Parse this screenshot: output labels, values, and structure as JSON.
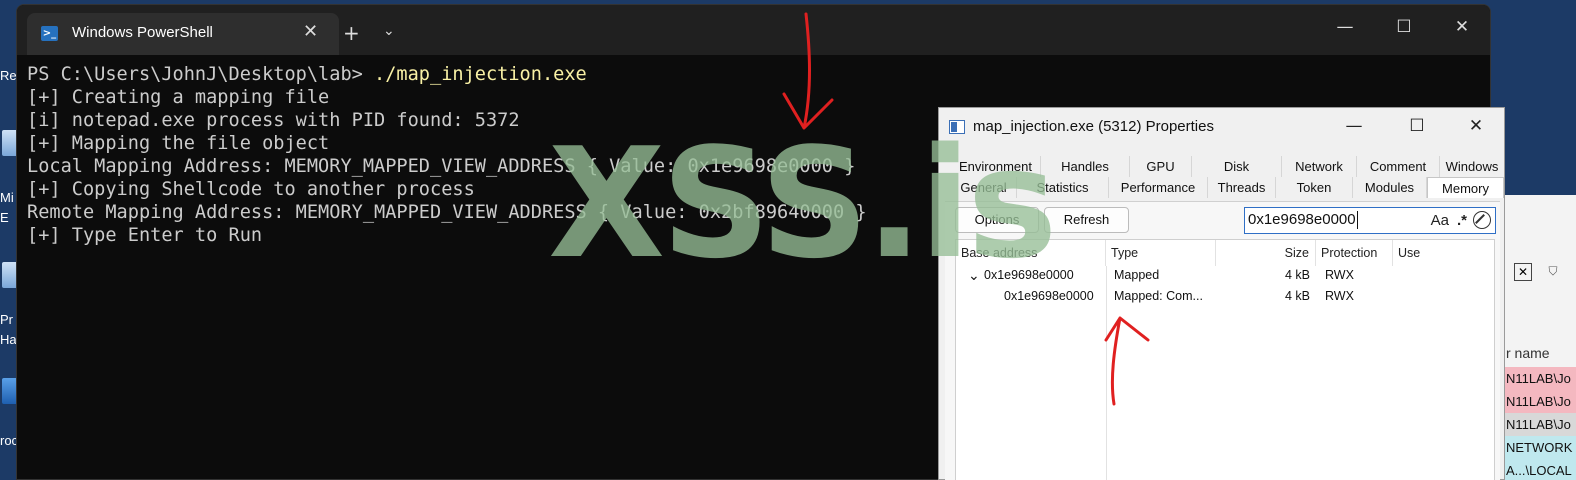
{
  "desktop": {
    "labels": [
      "Rec",
      "Mi",
      "E",
      "Pr",
      "Ha",
      "roc"
    ]
  },
  "powershell": {
    "tab_title": "Windows PowerShell",
    "tab_close": "✕",
    "new_tab": "+",
    "dropdown": "⌄",
    "minimize": "—",
    "maximize": "☐",
    "close": "✕",
    "prompt": "PS C:\\Users\\JohnJ\\Desktop\\lab> ",
    "command": "./map_injection.exe",
    "lines": [
      "[+] Creating a mapping file",
      "[i] notepad.exe process with PID found: 5372",
      "[+] Mapping the file object",
      "Local Mapping Address: MEMORY_MAPPED_VIEW_ADDRESS { Value: 0x1e9698e0000 }",
      "[+] Copying Shellcode to another process",
      "Remote Mapping Address: MEMORY_MAPPED_VIEW_ADDRESS { Value: 0x2bf89640000 }",
      "[+] Type Enter to Run"
    ]
  },
  "watermark": "XSS.is",
  "properties": {
    "title": "map_injection.exe (5312) Properties",
    "minimize": "—",
    "maximize": "☐",
    "close": "✕",
    "tabs_row1": [
      "Environment",
      "Handles",
      "GPU",
      "Disk",
      "Network",
      "Comment",
      "Windows"
    ],
    "tabs_row2": [
      "General",
      "Statistics",
      "Performance",
      "Threads",
      "Token",
      "Modules",
      "Memory"
    ],
    "options_label": "Options",
    "refresh_label": "Refresh",
    "search_value": "0x1e9698e0000",
    "search_case": "Aa",
    "search_regex": ".*",
    "columns": [
      "Base address",
      "Type",
      "Size",
      "Protection",
      "Use"
    ],
    "rows": [
      {
        "expander": "⌄",
        "base": "0x1e9698e0000",
        "type": "Mapped",
        "size": "4 kB",
        "protection": "RWX",
        "use": ""
      },
      {
        "expander": "",
        "base": "0x1e9698e0000",
        "type": "Mapped: Com...",
        "size": "4 kB",
        "protection": "RWX",
        "use": ""
      }
    ]
  },
  "background_window": {
    "header": "r name",
    "rows": [
      "N11LAB\\Jo",
      "N11LAB\\Jo",
      "N11LAB\\Jo",
      "NETWORK",
      "A...\\LOCAL"
    ],
    "row_colors": [
      "#f4b8c0",
      "#f4b8c0",
      "#d8d8d8",
      "#bfe8ee",
      "#bfe8ee"
    ]
  },
  "colors": {
    "console_bg": "#0c0c0c",
    "console_text": "#cccccc",
    "command_text": "#f9f1a5",
    "accent": "#2f6fc6",
    "annotation": "#e02020"
  }
}
